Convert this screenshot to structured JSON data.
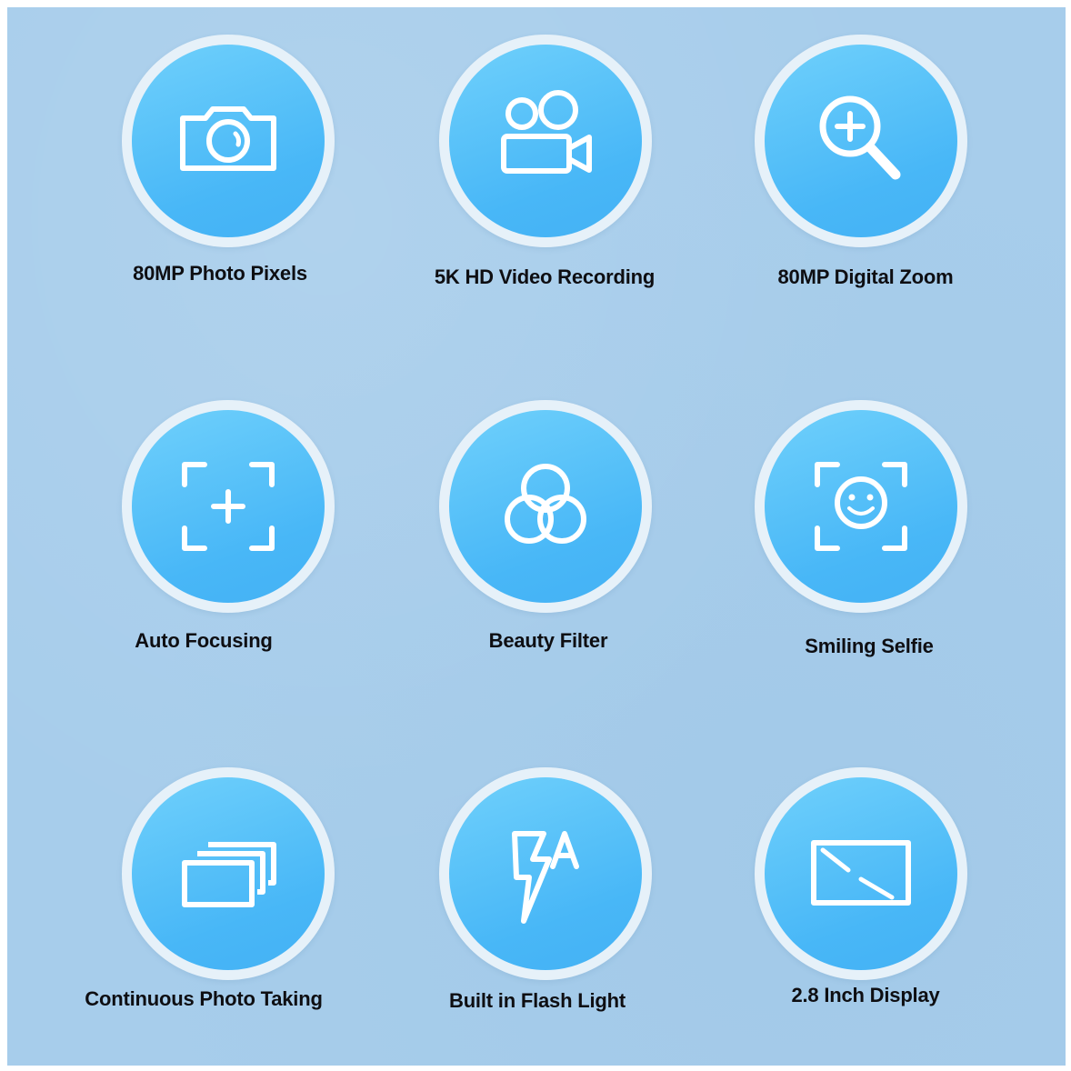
{
  "features": [
    {
      "label": "80MP Photo Pixels",
      "icon": "camera-icon"
    },
    {
      "label": "5K HD Video Recording",
      "icon": "video-camera-icon"
    },
    {
      "label": "80MP Digital Zoom",
      "icon": "zoom-in-icon"
    },
    {
      "label": "Auto Focusing",
      "icon": "focus-frame-icon"
    },
    {
      "label": "Beauty Filter",
      "icon": "filter-circles-icon"
    },
    {
      "label": "Smiling Selfie",
      "icon": "smile-face-frame-icon"
    },
    {
      "label": "Continuous Photo Taking",
      "icon": "stacked-photos-icon"
    },
    {
      "label": "Built in Flash Light",
      "icon": "auto-flash-icon"
    },
    {
      "label": "2.8 Inch Display",
      "icon": "display-screen-icon"
    }
  ],
  "colors": {
    "background": "#a7cdeb",
    "ring": "#e6f1f9",
    "disc": "#52bdf8",
    "icon": "#ffffff",
    "label": "#0e0e12"
  }
}
